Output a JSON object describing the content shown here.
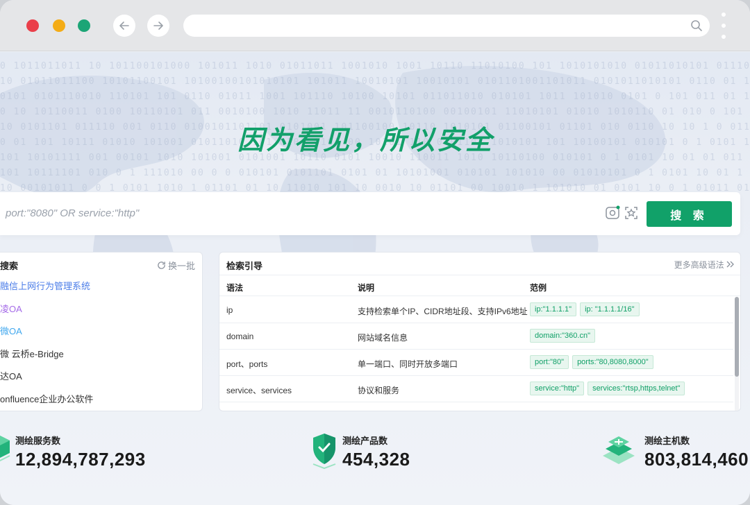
{
  "slogan": "因为看见，所以安全",
  "search": {
    "placeholder": "port:\"8080\" OR service:\"http\"",
    "button_label": "搜 索"
  },
  "hot_panel": {
    "title": "搜索",
    "refresh_label": "换一批",
    "items": [
      {
        "label": "融信上网行为管理系统",
        "color": "#4b7de8"
      },
      {
        "label": "凌OA",
        "color": "#a56be8"
      },
      {
        "label": "微OA",
        "color": "#42a8ee"
      },
      {
        "label": "微 云桥e-Bridge",
        "color": "#333333"
      },
      {
        "label": "达OA",
        "color": "#333333"
      },
      {
        "label": "onfluence企业办公软件",
        "color": "#333333"
      }
    ]
  },
  "guide_panel": {
    "title": "检索引导",
    "more_label": "更多高级语法",
    "columns": [
      "语法",
      "说明",
      "范例"
    ],
    "rows": [
      {
        "syntax": "ip",
        "desc": "支持检索单个IP、CIDR地址段、支持IPv6地址",
        "examples": [
          "ip:\"1.1.1.1\"",
          "ip: \"1.1.1.1/16\""
        ]
      },
      {
        "syntax": "domain",
        "desc": "网站域名信息",
        "examples": [
          "domain:\"360.cn\""
        ]
      },
      {
        "syntax": "port、ports",
        "desc": "单一端口、同时开放多端口",
        "examples": [
          "port:\"80\"",
          "ports:\"80,8080,8000\""
        ]
      },
      {
        "syntax": "service、services",
        "desc": "协议和服务",
        "examples": [
          "service:\"http\"",
          "services:\"rtsp,https,telnet\""
        ]
      }
    ]
  },
  "stats": [
    {
      "label": "测绘服务数",
      "value": "12,894,787,293"
    },
    {
      "label": "测绘产品数",
      "value": "454,328"
    },
    {
      "label": "测绘主机数",
      "value": "803,814,460"
    }
  ],
  "colors": {
    "brand": "#11a169",
    "window_red": "#ea3f4a",
    "window_yellow": "#f4ac16",
    "window_green": "#1ca576"
  },
  "icons": {
    "back": "arrow-left-icon",
    "forward": "arrow-right-icon",
    "search": "magnifier-icon",
    "menu": "kebab-menu-icon",
    "refresh": "refresh-icon",
    "more": "double-chevron-right-icon"
  }
}
